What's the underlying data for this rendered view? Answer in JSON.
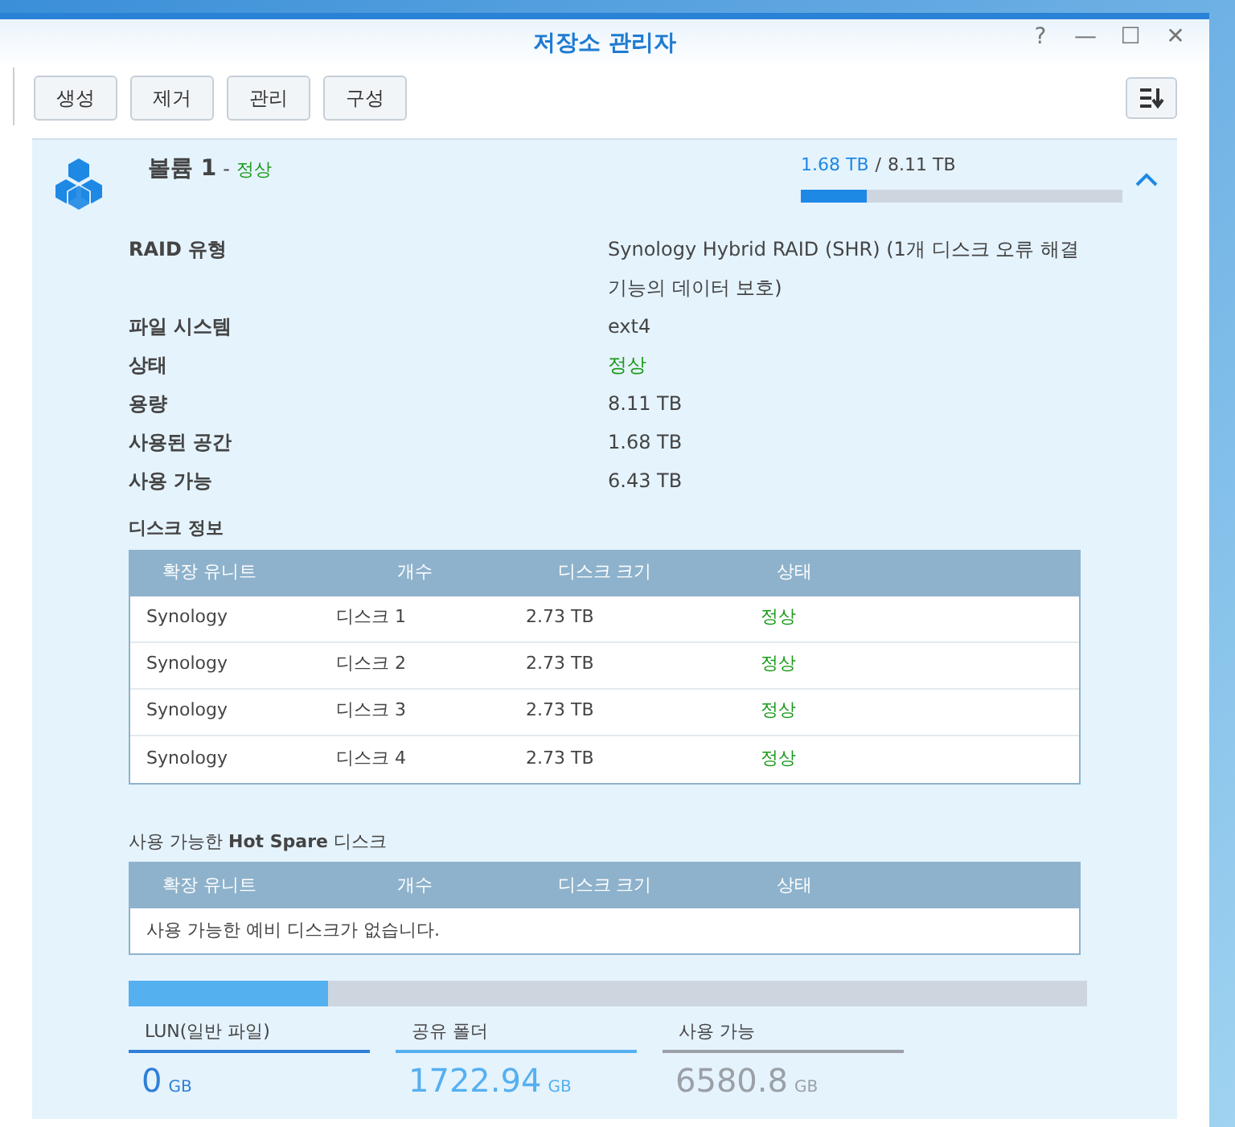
{
  "window": {
    "title": "저장소 관리자",
    "controls": [
      "?",
      "—",
      "☐",
      "✕"
    ]
  },
  "toolbar": {
    "buttons": [
      "생성",
      "제거",
      "관리",
      "구성"
    ]
  },
  "volume": {
    "name": "볼륨 1",
    "separator": "-",
    "status": "정상",
    "used": "1.68 TB",
    "total_separator": "/",
    "total": "8.11 TB",
    "level": 0.207,
    "expanded": true,
    "details": [
      {
        "label": "RAID 유형",
        "value": "Synology Hybrid RAID (SHR) (1개 디스크 오류 해결 기능의 데이터 보호)",
        "kind": "text"
      },
      {
        "label": "파일 시스템",
        "value": "ext4",
        "kind": "text"
      },
      {
        "label": "상태",
        "value": "정상",
        "kind": "status"
      },
      {
        "label": "용량",
        "value": "8.11 TB",
        "kind": "text"
      },
      {
        "label": "사용된 공간",
        "value": "1.68 TB",
        "kind": "text"
      },
      {
        "label": "사용 가능",
        "value": "6.43 TB",
        "kind": "text"
      }
    ],
    "disk_info": {
      "title": "디스크 정보",
      "columns": [
        "확장 유니트",
        "개수",
        "디스크 크기",
        "상태"
      ],
      "rows": [
        [
          "Synology",
          "디스크 1",
          "2.73 TB",
          "정상"
        ],
        [
          "Synology",
          "디스크 2",
          "2.73 TB",
          "정상"
        ],
        [
          "Synology",
          "디스크 3",
          "2.73 TB",
          "정상"
        ],
        [
          "Synology",
          "디스크 4",
          "2.73 TB",
          "정상"
        ]
      ]
    },
    "hot_spare": {
      "title": "사용 가능한 **Hot Spare** 디스크",
      "columns": [
        "확장 유니트",
        "개수",
        "디스크 크기",
        "상태"
      ],
      "empty_message": "사용 가능한 예비 디스크가 없습니다."
    },
    "storage_bar": {
      "level": 0.208
    },
    "usage": [
      {
        "label": "LUN(일반 파일)",
        "value": "0",
        "unit": "GB",
        "color": "#2f7fd6"
      },
      {
        "label": "공유 폴더",
        "value": "1722.94",
        "unit": "GB",
        "color": "#55b0f0"
      },
      {
        "label": "사용 가능",
        "value": "6580.8",
        "unit": "GB",
        "color": "#9aa0a6"
      }
    ]
  }
}
